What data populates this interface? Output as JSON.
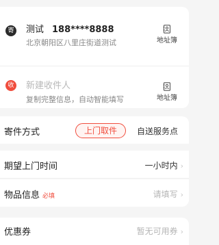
{
  "sender": {
    "badge": "寄",
    "name": "测试",
    "phone": "188****8888",
    "address": "北京朝阳区八里庄街道测试",
    "book_label": "地址簿"
  },
  "receiver": {
    "badge": "收",
    "placeholder": "新建收件人",
    "hint": "复制完整信息，自动智能填写",
    "book_label": "地址簿"
  },
  "shipping_method": {
    "label": "寄件方式",
    "options": [
      "上门取件",
      "自送服务点"
    ],
    "selected": "上门取件"
  },
  "pickup_time": {
    "label": "期望上门时间",
    "value": "一小时内"
  },
  "goods_info": {
    "label": "物品信息",
    "required_tag": "必填",
    "value": "请填写"
  },
  "coupon": {
    "label": "优惠券",
    "value": "暂无可用券"
  },
  "colors": {
    "accent": "#f04d3d",
    "background": "#f5f5f5"
  }
}
